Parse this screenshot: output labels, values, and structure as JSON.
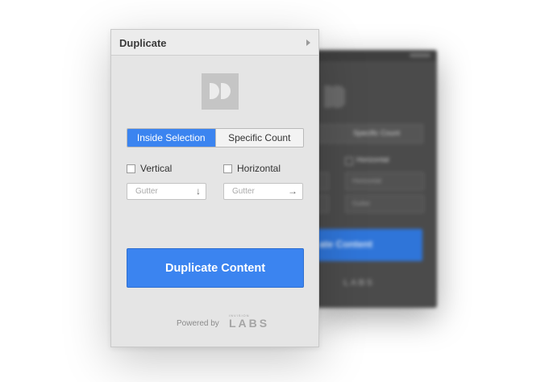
{
  "panel": {
    "title": "Duplicate",
    "menu_icon": "chevron-right-icon",
    "logo_icon": "double-d-logo-icon"
  },
  "mode_tabs": [
    {
      "label": "Inside Selection",
      "active": true
    },
    {
      "label": "Specific Count",
      "active": false
    }
  ],
  "options": {
    "vertical": {
      "label": "Vertical",
      "checked": false
    },
    "horizontal": {
      "label": "Horizontal",
      "checked": false
    }
  },
  "gutter_fields": {
    "vertical": {
      "placeholder": "Gutter",
      "value": "",
      "icon": "arrow-down-icon",
      "glyph": "↓"
    },
    "horizontal": {
      "placeholder": "Gutter",
      "value": "",
      "icon": "arrow-right-icon",
      "glyph": "→"
    }
  },
  "primary_button": {
    "label": "Duplicate Content"
  },
  "footer": {
    "powered_by": "Powered by",
    "brand_small": "INVISION",
    "brand": "LABS"
  },
  "background_panel": {
    "tab_label": "Specific Count",
    "check_label": "Horizontal",
    "field_1": "Horizontal",
    "field_2": "Gutter",
    "button_label": "ate Content",
    "brand": "LABS"
  },
  "colors": {
    "accent": "#3b84f0",
    "panel_bg": "#e5e5e5",
    "dark_bg": "#4b4b4b"
  }
}
